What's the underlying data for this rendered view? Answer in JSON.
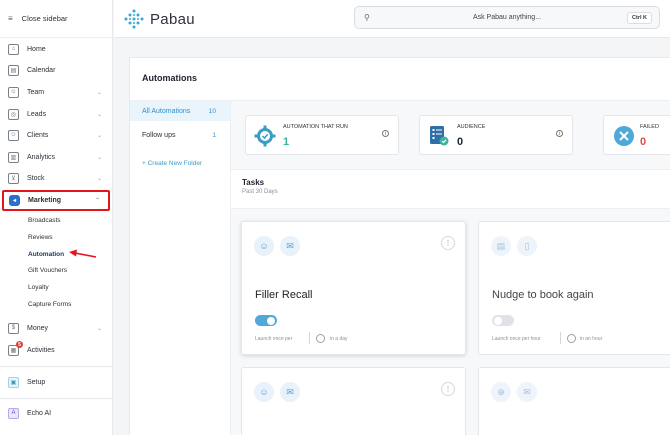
{
  "sidebar": {
    "close": "Close sidebar",
    "items": [
      {
        "label": "Home",
        "icon": "home-icon"
      },
      {
        "label": "Calendar",
        "icon": "calendar-icon"
      },
      {
        "label": "Team",
        "icon": "team-icon"
      },
      {
        "label": "Leads",
        "icon": "leads-icon"
      },
      {
        "label": "Clients",
        "icon": "clients-icon"
      },
      {
        "label": "Analytics",
        "icon": "analytics-icon"
      },
      {
        "label": "Stock",
        "icon": "cart-icon"
      },
      {
        "label": "Marketing",
        "icon": "megaphone-icon"
      }
    ],
    "marketing_sub": [
      "Broadcasts",
      "Reviews",
      "Automation",
      "Gift Vouchers",
      "Loyalty",
      "Capture Forms"
    ],
    "money": "Money",
    "activities": "Activities",
    "activities_badge": "5",
    "setup": "Setup",
    "echo": "Echo AI"
  },
  "topbar": {
    "logo": "Pabau",
    "search_placeholder": "Ask Pabau anything...",
    "shortcut": "Ctrl K"
  },
  "page": {
    "title": "Automations",
    "folders": [
      {
        "label": "All Automations",
        "count": "10"
      },
      {
        "label": "Follow ups",
        "count": "1"
      }
    ],
    "new_folder": "+ Create New Folder",
    "stats": [
      {
        "title": "AUTOMATION THAT RUN",
        "value": "1",
        "color": "#3bb3a0"
      },
      {
        "title": "AUDIENCE",
        "value": "0",
        "color": "#1f2330"
      },
      {
        "title": "FAILED",
        "value": "0",
        "color": "#e24a4a"
      }
    ],
    "tasks_title": "Tasks",
    "tasks_sub": "Past 30 Days",
    "cards": [
      {
        "title": "Filler Recall",
        "launch": "Launch once per",
        "freq": "in a day",
        "active": true
      },
      {
        "title": "Nudge to book again",
        "launch": "Launch once per hour",
        "freq": "in an hour",
        "active": false
      }
    ]
  },
  "colors": {
    "accent": "#2f8fd0",
    "highlight": "#e3141b"
  }
}
